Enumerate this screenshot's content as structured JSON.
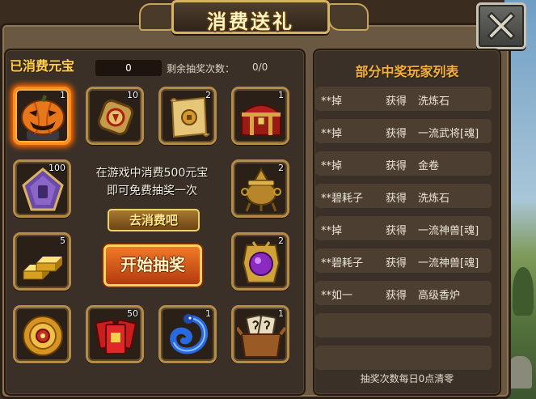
{
  "dialog": {
    "title": "消费送礼",
    "close_icon": "close-x-icon"
  },
  "spent": {
    "label": "已消费元宝",
    "value": "0"
  },
  "remaining": {
    "label": "剩余抽奖次数：",
    "value": "0/0"
  },
  "items": [
    {
      "icon": "pumpkin-icon",
      "count": "1",
      "selected": true
    },
    {
      "icon": "token-icon",
      "count": "10"
    },
    {
      "icon": "scroll-icon",
      "count": "2"
    },
    {
      "icon": "treasure-chest-icon",
      "count": "1"
    },
    {
      "icon": "purple-badge-icon",
      "count": "100"
    },
    {
      "icon": "incense-burner-icon",
      "count": "2"
    },
    {
      "icon": "gold-bars-icon",
      "count": "5"
    },
    {
      "icon": "purple-amulet-icon",
      "count": "2"
    },
    {
      "icon": "gold-medallion-icon"
    },
    {
      "icon": "red-envelopes-icon",
      "count": "50"
    },
    {
      "icon": "blue-dragon-icon",
      "count": "1"
    },
    {
      "icon": "mystery-box-icon",
      "count": "1"
    }
  ],
  "promo": {
    "line1": "在游戏中消费500元宝",
    "line2": "即可免费抽奖一次"
  },
  "go_spend_button": "去消费吧",
  "start_button": "开始抽奖",
  "winners": {
    "title": "部分中奖玩家列表",
    "rows": [
      {
        "player": "**掉",
        "action": "获得",
        "prize": "洗炼石"
      },
      {
        "player": "**掉",
        "action": "获得",
        "prize": "一流武将[魂]"
      },
      {
        "player": "**掉",
        "action": "获得",
        "prize": "金卷"
      },
      {
        "player": "**碧耗子",
        "action": "获得",
        "prize": "洗炼石"
      },
      {
        "player": "**掉",
        "action": "获得",
        "prize": "一流神兽[魂]"
      },
      {
        "player": "**碧耗子",
        "action": "获得",
        "prize": "一流神兽[魂]"
      },
      {
        "player": "**如一",
        "action": "获得",
        "prize": "高级香炉"
      }
    ],
    "footer": "抽奖次数每日0点清零"
  },
  "colors": {
    "frame": "#6b5842",
    "panel": "#3b3027",
    "accent_gold": "#ffd24a",
    "slot_border": "#b48c48",
    "selected_glow": "#ff8c1c",
    "start_button": "#e0621e",
    "list_title": "#f2b23c"
  }
}
